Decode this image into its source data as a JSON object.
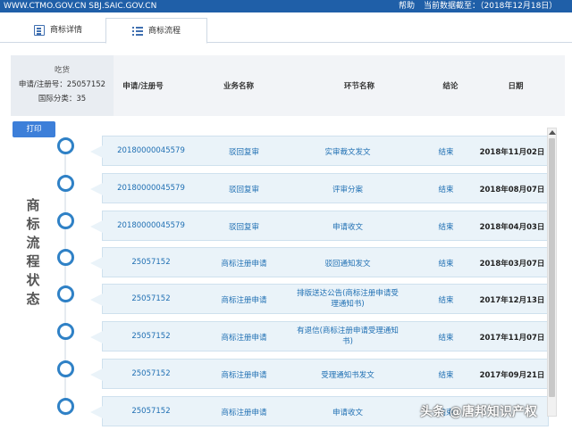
{
  "topbar": {
    "url": "WWW.CTMO.GOV.CN SBJ.SAIC.GOV.CN",
    "help": "帮助",
    "data_date": "当前数据截至：（2018年12月18日）"
  },
  "tabs": [
    {
      "label": "商标详情",
      "icon": "document-icon"
    },
    {
      "label": "商标流程",
      "icon": "list-icon",
      "active": true
    }
  ],
  "info": {
    "goods": "吃货",
    "reg_no": "申请/注册号：25057152",
    "class": "国际分类：35"
  },
  "table_header": {
    "reg": "申请/注册号",
    "business": "业务名称",
    "step": "环节名称",
    "result": "结论",
    "date": "日期"
  },
  "print_label": "打印",
  "vertical_title": [
    "商",
    "标",
    "流",
    "程",
    "状",
    "态"
  ],
  "rows": [
    {
      "reg": "20180000045579",
      "business": "驳回复审",
      "step": "实审裁文发文",
      "result": "结束",
      "date": "2018年11月02日"
    },
    {
      "reg": "20180000045579",
      "business": "驳回复审",
      "step": "评审分案",
      "result": "结束",
      "date": "2018年08月07日"
    },
    {
      "reg": "20180000045579",
      "business": "驳回复审",
      "step": "申请收文",
      "result": "结束",
      "date": "2018年04月03日"
    },
    {
      "reg": "25057152",
      "business": "商标注册申请",
      "step": "驳回通知发文",
      "result": "结束",
      "date": "2018年03月07日"
    },
    {
      "reg": "25057152",
      "business": "商标注册申请",
      "step": "排版送达公告(商标注册申请受理通知书)",
      "result": "结束",
      "date": "2017年12月13日"
    },
    {
      "reg": "25057152",
      "business": "商标注册申请",
      "step": "有退信(商标注册申请受理通知书)",
      "result": "结束",
      "date": "2017年11月07日"
    },
    {
      "reg": "25057152",
      "business": "商标注册申请",
      "step": "受理通知书发文",
      "result": "结束",
      "date": "2017年09月21日"
    },
    {
      "reg": "25057152",
      "business": "商标注册申请",
      "step": "申请收文",
      "result": "结束",
      "date": ""
    }
  ],
  "watermark": "头条 @唐邦知识产权"
}
